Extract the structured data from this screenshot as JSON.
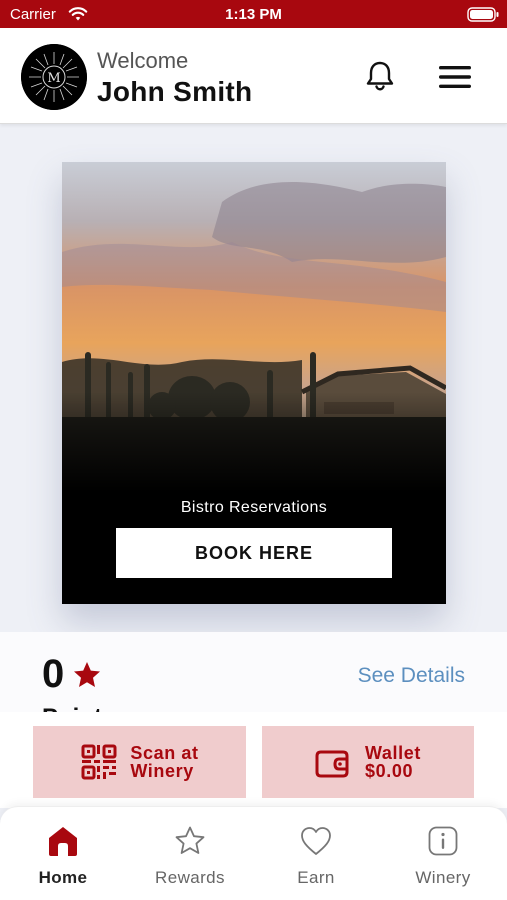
{
  "status_bar": {
    "carrier": "Carrier",
    "time": "1:13 PM",
    "icons": [
      "wifi-icon",
      "battery-icon"
    ]
  },
  "header": {
    "welcome": "Welcome",
    "user_name": "John Smith",
    "avatar_letter": "M",
    "icons": [
      "bell-icon",
      "menu-icon"
    ]
  },
  "hero": {
    "caption": "Bistro Reservations",
    "button_label": "BOOK HERE"
  },
  "points": {
    "value": "0",
    "label": "Points",
    "see_details": "See Details",
    "icon": "star-icon"
  },
  "actions": {
    "scan": {
      "line1": "Scan at",
      "line2": "Winery",
      "icon": "qr-code-icon"
    },
    "wallet": {
      "line1": "Wallet",
      "line2": "$0.00",
      "icon": "wallet-icon"
    }
  },
  "tabs": [
    {
      "label": "Home",
      "icon": "home-icon",
      "active": true
    },
    {
      "label": "Rewards",
      "icon": "star-outline-icon",
      "active": false
    },
    {
      "label": "Earn",
      "icon": "heart-icon",
      "active": false
    },
    {
      "label": "Winery",
      "icon": "info-icon",
      "active": false
    }
  ],
  "colors": {
    "brand": "#a8080f",
    "tile": "#f0cccd",
    "link": "#5c8fbf"
  }
}
